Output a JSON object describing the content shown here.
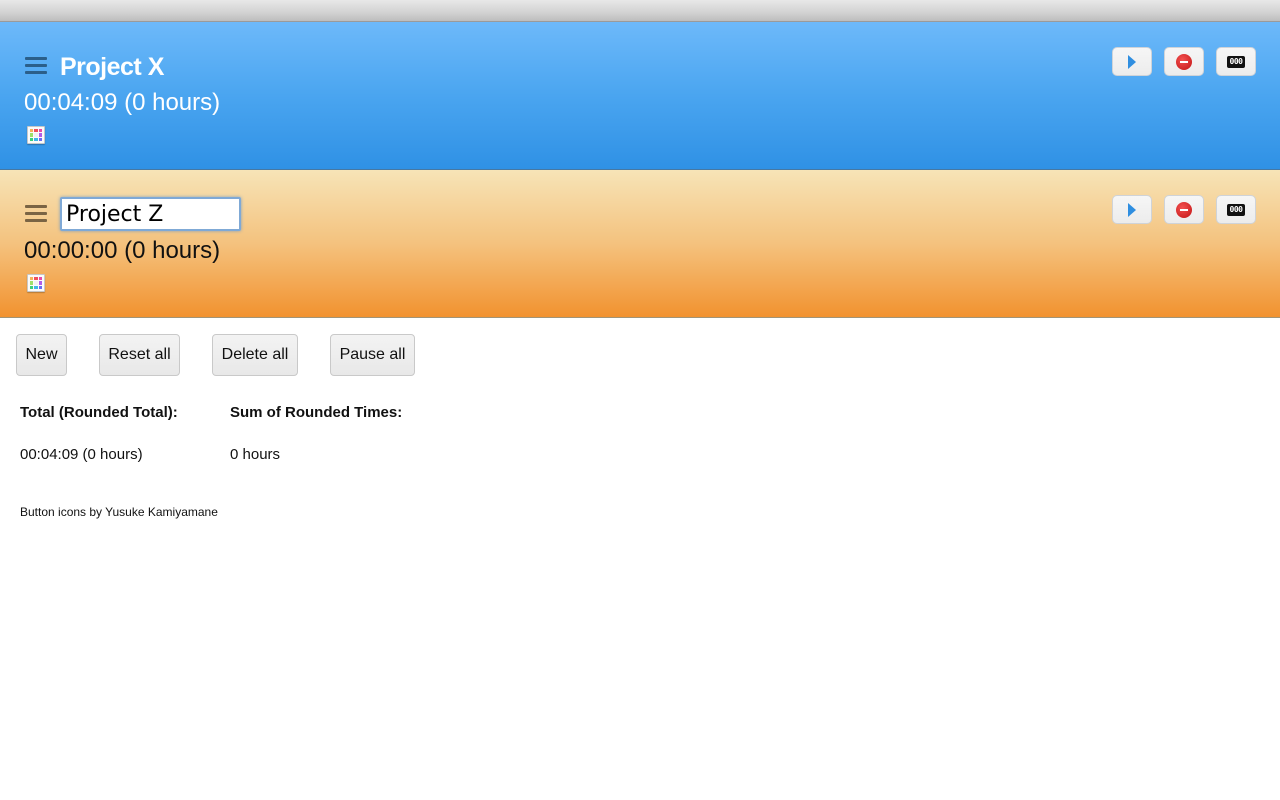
{
  "timers": [
    {
      "name": "Project X",
      "editing": false,
      "time": "00:04:09 (0 hours)",
      "theme": "blue",
      "colors": {
        "gradient_top": "#6db9fa",
        "gradient_bottom": "#2f91e5"
      }
    },
    {
      "name": "Project Z",
      "editing": true,
      "time": "00:00:00 (0 hours)",
      "theme": "orange",
      "colors": {
        "gradient_top": "#f7e4b7",
        "gradient_bottom": "#f2922f"
      }
    }
  ],
  "timer_controls": {
    "start": {
      "icon": "play-icon",
      "label": "Start"
    },
    "stop": {
      "icon": "stop-icon",
      "label": "Stop"
    },
    "reset": {
      "icon": "counter-reset-icon",
      "glyph": "000",
      "label": "Reset"
    },
    "menu_icon": "hamburger-menu-icon",
    "color_picker_icon": "color-palette-icon"
  },
  "palette_colors": [
    "#f7b35a",
    "#f0505a",
    "#e84aa8",
    "#9fe06a",
    "#f2f2f2",
    "#b25ce8",
    "#3bd07a",
    "#3fb7e8",
    "#6c6cf0"
  ],
  "actions": {
    "new": "New",
    "reset_all": "Reset all",
    "delete_all": "Delete all",
    "pause_all": "Pause all"
  },
  "totals": {
    "total_label": "Total (Rounded Total):",
    "total_value": "00:04:09 (0 hours)",
    "sum_label": "Sum of Rounded Times:",
    "sum_value": "0 hours"
  },
  "credit": "Button icons by Yusuke Kamiyamane"
}
